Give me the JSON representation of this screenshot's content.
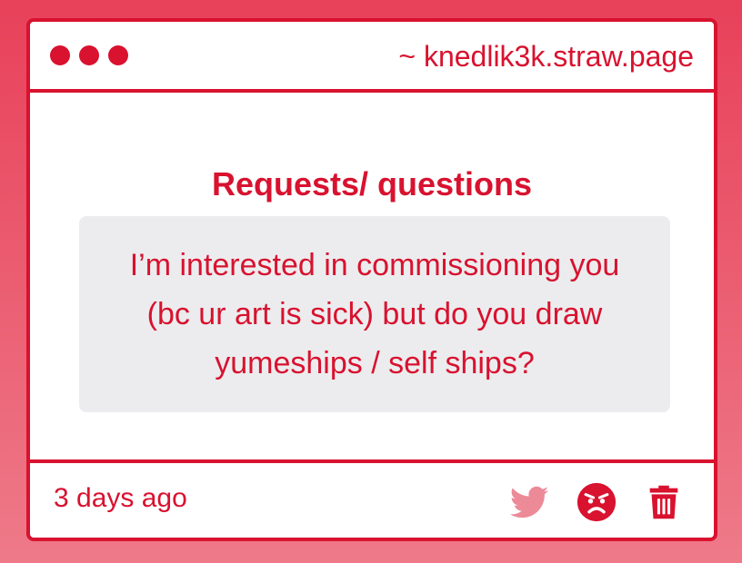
{
  "window": {
    "url": "~ knedlik3k.straw.page"
  },
  "content": {
    "heading": "Requests/ questions",
    "message": "I’m interested in commissioning you (bc ur art is sick) but do you draw yumeships / self ships?"
  },
  "footer": {
    "timestamp": "3 days ago",
    "icons": [
      "twitter-icon",
      "angry-face-icon",
      "trash-icon"
    ]
  },
  "colors": {
    "accent": "#d8122f",
    "message_bg": "#ececee",
    "twitter_faded": "#ec8a98",
    "background_top": "#e8415a",
    "background_bottom": "#ee7a89"
  }
}
